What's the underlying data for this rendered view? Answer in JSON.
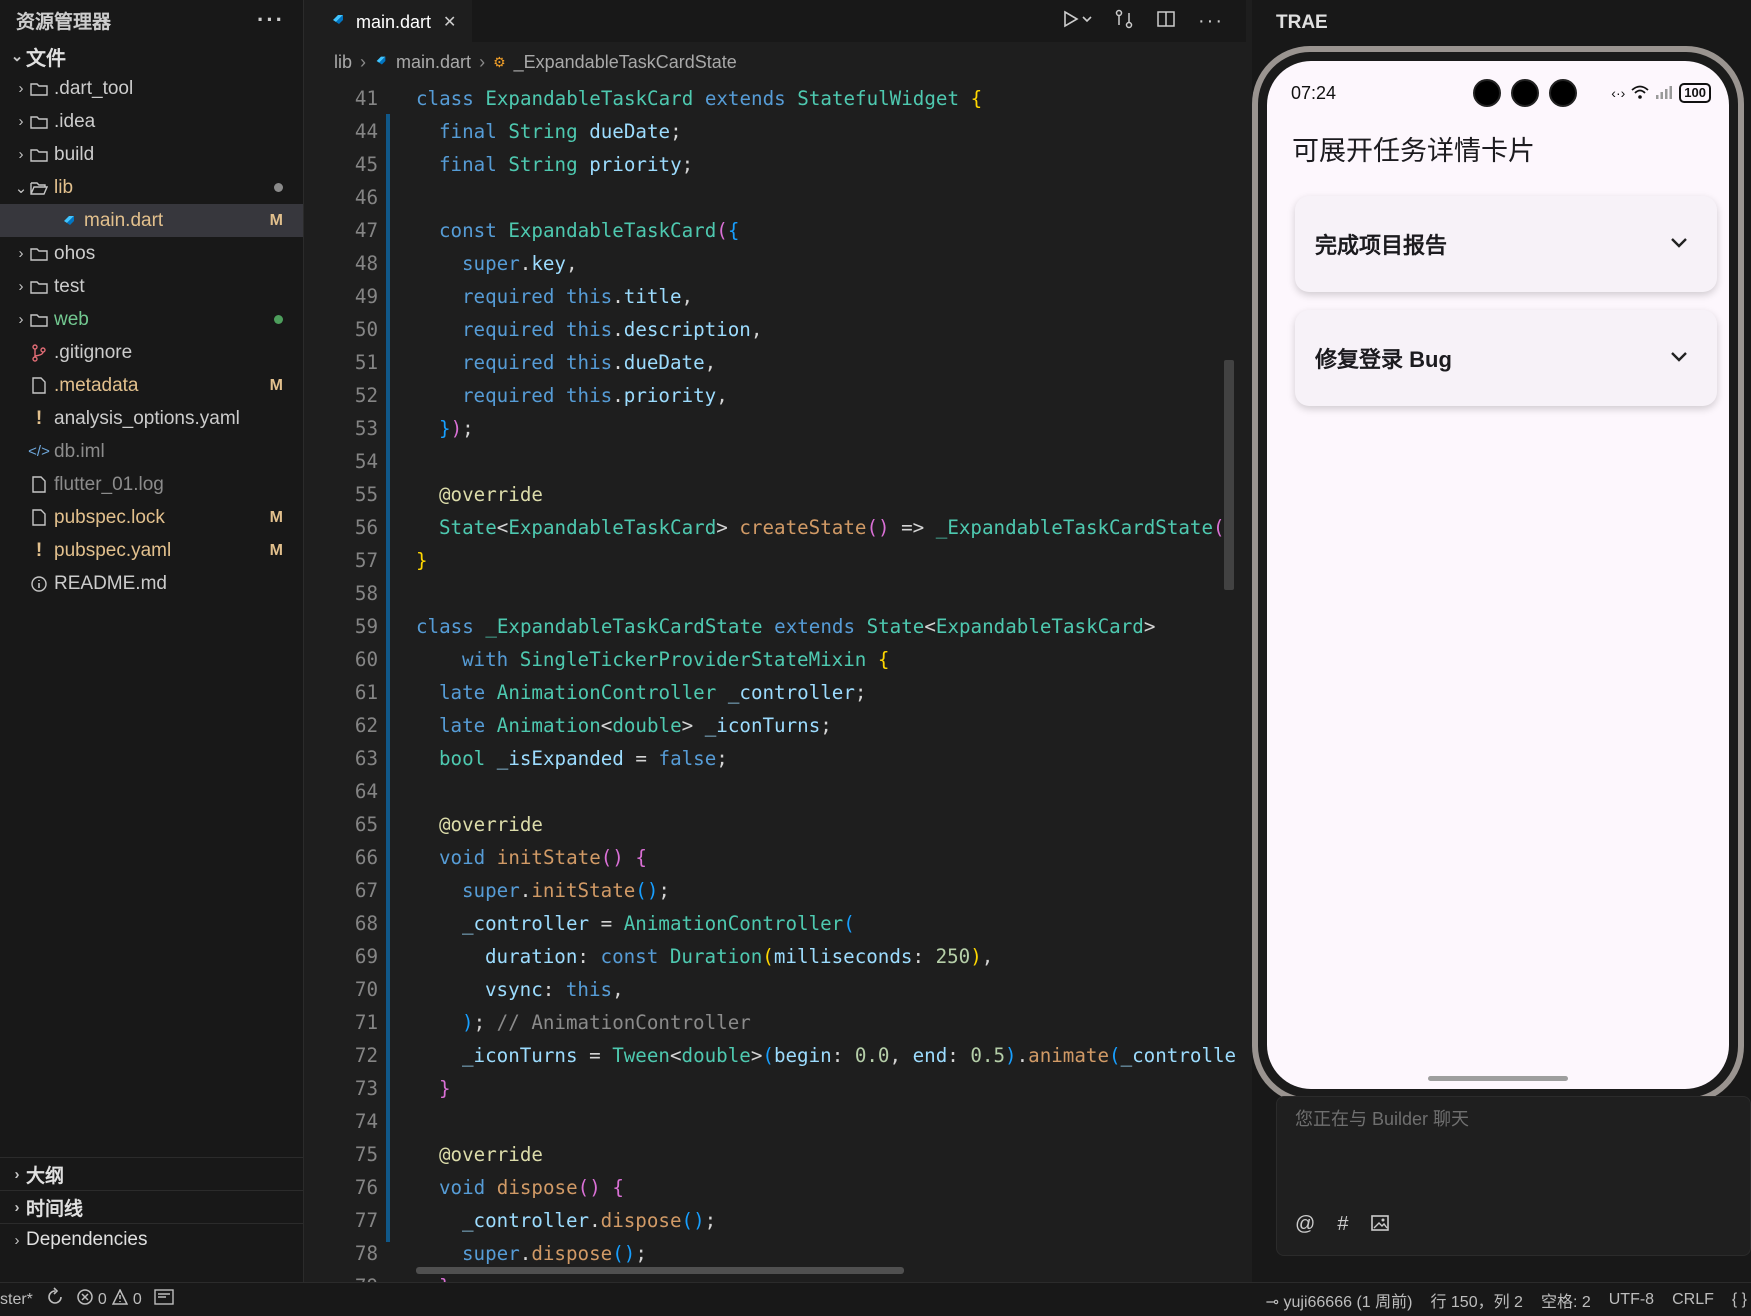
{
  "explorer": {
    "title": "资源管理器",
    "more": "···",
    "section": "文件",
    "items": [
      {
        "label": ".dart_tool",
        "kind": "folder",
        "icon": "folder-icon",
        "depth": 0,
        "badge": "",
        "color": "#cccccc"
      },
      {
        "label": ".idea",
        "kind": "folder",
        "icon": "folder-icon",
        "depth": 0,
        "badge": "",
        "color": "#cccccc"
      },
      {
        "label": "build",
        "kind": "folder",
        "icon": "folder-icon",
        "depth": 0,
        "badge": "",
        "color": "#cccccc"
      },
      {
        "label": "lib",
        "kind": "folder-open",
        "icon": "folder-open-icon",
        "depth": 0,
        "badge": "",
        "color": "#e2c08d",
        "dot": "#8a8a8a"
      },
      {
        "label": "main.dart",
        "kind": "dart",
        "icon": "dart-file-icon",
        "depth": 1,
        "badge": "M",
        "color": "#e2c08d",
        "selected": true
      },
      {
        "label": "ohos",
        "kind": "folder",
        "icon": "folder-icon",
        "depth": 0,
        "badge": "",
        "color": "#cccccc"
      },
      {
        "label": "test",
        "kind": "folder",
        "icon": "folder-icon",
        "depth": 0,
        "badge": "",
        "color": "#cccccc"
      },
      {
        "label": "web",
        "kind": "folder",
        "icon": "folder-icon",
        "depth": 0,
        "badge": "",
        "color": "#73c991",
        "dot": "#4d9e5c"
      },
      {
        "label": ".gitignore",
        "kind": "git",
        "icon": "git-icon",
        "depth": 0,
        "badge": "",
        "color": "#cccccc"
      },
      {
        "label": ".metadata",
        "kind": "file",
        "icon": "file-icon",
        "depth": 0,
        "badge": "M",
        "color": "#e2c08d"
      },
      {
        "label": "analysis_options.yaml",
        "kind": "yaml",
        "icon": "exclamation-icon",
        "depth": 0,
        "badge": "",
        "color": "#cccccc"
      },
      {
        "label": "db.iml",
        "kind": "xml",
        "icon": "code-brackets-icon",
        "depth": 0,
        "badge": "",
        "color": "#8c8c8c"
      },
      {
        "label": "flutter_01.log",
        "kind": "file",
        "icon": "file-icon",
        "depth": 0,
        "badge": "",
        "color": "#8c8c8c"
      },
      {
        "label": "pubspec.lock",
        "kind": "file",
        "icon": "file-icon",
        "depth": 0,
        "badge": "M",
        "color": "#e2c08d"
      },
      {
        "label": "pubspec.yaml",
        "kind": "yaml",
        "icon": "exclamation-icon",
        "depth": 0,
        "badge": "M",
        "color": "#e2c08d"
      },
      {
        "label": "README.md",
        "kind": "info",
        "icon": "info-icon",
        "depth": 0,
        "badge": "",
        "color": "#cccccc"
      }
    ],
    "bottom_sections": [
      "大纲",
      "时间线",
      "Dependencies"
    ]
  },
  "editor": {
    "tab_label": "main.dart",
    "tab_close": "✕",
    "breadcrumb": [
      "lib",
      "main.dart",
      "_ExpandableTaskCardState"
    ],
    "lines": [
      {
        "n": "41",
        "i": 0,
        "t": [
          [
            "class",
            "k"
          ],
          [
            " "
          ],
          [
            "ExpandableTaskCard",
            "t"
          ],
          [
            " "
          ],
          [
            "extends",
            "k"
          ],
          [
            " "
          ],
          [
            "StatefulWidget",
            "t"
          ],
          [
            " "
          ],
          [
            "{",
            "p"
          ]
        ]
      },
      {
        "n": "44",
        "i": 1,
        "t": [
          [
            "final",
            "k"
          ],
          [
            " "
          ],
          [
            "String",
            "t"
          ],
          [
            " "
          ],
          [
            "dueDate",
            "v"
          ],
          [
            ";"
          ]
        ]
      },
      {
        "n": "45",
        "i": 1,
        "t": [
          [
            "final",
            "k"
          ],
          [
            " "
          ],
          [
            "String",
            "t"
          ],
          [
            " "
          ],
          [
            "priority",
            "v"
          ],
          [
            ";"
          ]
        ]
      },
      {
        "n": "46",
        "i": 0,
        "t": []
      },
      {
        "n": "47",
        "i": 1,
        "t": [
          [
            "const",
            "k"
          ],
          [
            " "
          ],
          [
            "ExpandableTaskCard",
            "t"
          ],
          [
            "(",
            "p2"
          ],
          [
            "{",
            "p3"
          ]
        ]
      },
      {
        "n": "48",
        "i": 2,
        "t": [
          [
            "super",
            "k"
          ],
          [
            "."
          ],
          [
            "key",
            "v"
          ],
          [
            ","
          ]
        ]
      },
      {
        "n": "49",
        "i": 2,
        "t": [
          [
            "required",
            "k"
          ],
          [
            " "
          ],
          [
            "this",
            "k"
          ],
          [
            "."
          ],
          [
            "title",
            "v"
          ],
          [
            ","
          ]
        ]
      },
      {
        "n": "50",
        "i": 2,
        "t": [
          [
            "required",
            "k"
          ],
          [
            " "
          ],
          [
            "this",
            "k"
          ],
          [
            "."
          ],
          [
            "description",
            "v"
          ],
          [
            ","
          ]
        ]
      },
      {
        "n": "51",
        "i": 2,
        "t": [
          [
            "required",
            "k"
          ],
          [
            " "
          ],
          [
            "this",
            "k"
          ],
          [
            "."
          ],
          [
            "dueDate",
            "v"
          ],
          [
            ","
          ]
        ]
      },
      {
        "n": "52",
        "i": 2,
        "t": [
          [
            "required",
            "k"
          ],
          [
            " "
          ],
          [
            "this",
            "k"
          ],
          [
            "."
          ],
          [
            "priority",
            "v"
          ],
          [
            ","
          ]
        ]
      },
      {
        "n": "53",
        "i": 1,
        "t": [
          [
            "}",
            "p3"
          ],
          [
            ")",
            "p2"
          ],
          [
            ";"
          ]
        ]
      },
      {
        "n": "54",
        "i": 0,
        "t": []
      },
      {
        "n": "55",
        "i": 1,
        "t": [
          [
            "@override",
            "f"
          ]
        ]
      },
      {
        "n": "56",
        "i": 1,
        "t": [
          [
            "State",
            "t"
          ],
          [
            "<"
          ],
          [
            "ExpandableTaskCard",
            "t"
          ],
          [
            "> "
          ],
          [
            "createState",
            "fn"
          ],
          [
            "()",
            "p2"
          ],
          [
            " => "
          ],
          [
            "_ExpandableTaskCardState",
            "t"
          ],
          [
            "(",
            "p2"
          ]
        ]
      },
      {
        "n": "57",
        "i": 0,
        "t": [
          [
            "}",
            "p"
          ]
        ]
      },
      {
        "n": "58",
        "i": 0,
        "t": []
      },
      {
        "n": "59",
        "i": 0,
        "t": [
          [
            "class",
            "k"
          ],
          [
            " "
          ],
          [
            "_ExpandableTaskCardState",
            "t"
          ],
          [
            " "
          ],
          [
            "extends",
            "k"
          ],
          [
            " "
          ],
          [
            "State",
            "t"
          ],
          [
            "<"
          ],
          [
            "ExpandableTaskCard",
            "t"
          ],
          [
            ">"
          ]
        ]
      },
      {
        "n": "60",
        "i": 2,
        "t": [
          [
            "with",
            "k"
          ],
          [
            " "
          ],
          [
            "SingleTickerProviderStateMixin",
            "t"
          ],
          [
            " "
          ],
          [
            "{",
            "p"
          ]
        ]
      },
      {
        "n": "61",
        "i": 1,
        "t": [
          [
            "late",
            "k"
          ],
          [
            " "
          ],
          [
            "AnimationController",
            "t"
          ],
          [
            " "
          ],
          [
            "_controller",
            "v"
          ],
          [
            ";"
          ]
        ]
      },
      {
        "n": "62",
        "i": 1,
        "t": [
          [
            "late",
            "k"
          ],
          [
            " "
          ],
          [
            "Animation",
            "t"
          ],
          [
            "<"
          ],
          [
            "double",
            "t"
          ],
          [
            "> "
          ],
          [
            "_iconTurns",
            "v"
          ],
          [
            ";"
          ]
        ]
      },
      {
        "n": "63",
        "i": 1,
        "t": [
          [
            "bool",
            "t"
          ],
          [
            " "
          ],
          [
            "_isExpanded",
            "v"
          ],
          [
            " = "
          ],
          [
            "false",
            "k"
          ],
          [
            ";"
          ]
        ]
      },
      {
        "n": "64",
        "i": 0,
        "t": []
      },
      {
        "n": "65",
        "i": 1,
        "t": [
          [
            "@override",
            "f"
          ]
        ]
      },
      {
        "n": "66",
        "i": 1,
        "t": [
          [
            "void",
            "k"
          ],
          [
            " "
          ],
          [
            "initState",
            "fn"
          ],
          [
            "()",
            "p2"
          ],
          [
            " "
          ],
          [
            "{",
            "p2"
          ]
        ]
      },
      {
        "n": "67",
        "i": 2,
        "t": [
          [
            "super",
            "k"
          ],
          [
            "."
          ],
          [
            "initState",
            "fn"
          ],
          [
            "()",
            "p3"
          ],
          [
            ";"
          ]
        ]
      },
      {
        "n": "68",
        "i": 2,
        "t": [
          [
            "_controller",
            "v"
          ],
          [
            " = "
          ],
          [
            "AnimationController",
            "t"
          ],
          [
            "(",
            "p3"
          ]
        ]
      },
      {
        "n": "69",
        "i": 3,
        "t": [
          [
            "duration",
            "v"
          ],
          [
            ": "
          ],
          [
            "const",
            "k"
          ],
          [
            " "
          ],
          [
            "Duration",
            "t"
          ],
          [
            "(",
            "p"
          ],
          [
            "milliseconds",
            "v"
          ],
          [
            ": "
          ],
          [
            "250",
            "n"
          ],
          [
            ")",
            "p"
          ],
          [
            ","
          ]
        ]
      },
      {
        "n": "70",
        "i": 3,
        "t": [
          [
            "vsync",
            "v"
          ],
          [
            ": "
          ],
          [
            "this",
            "k"
          ],
          [
            ","
          ]
        ]
      },
      {
        "n": "71",
        "i": 2,
        "t": [
          [
            ")",
            "p3"
          ],
          [
            "; "
          ],
          [
            "// AnimationController",
            "cg"
          ]
        ]
      },
      {
        "n": "72",
        "i": 2,
        "t": [
          [
            "_iconTurns",
            "v"
          ],
          [
            " = "
          ],
          [
            "Tween",
            "t"
          ],
          [
            "<"
          ],
          [
            "double",
            "t"
          ],
          [
            ">"
          ],
          [
            "(",
            "p3"
          ],
          [
            "begin",
            "v"
          ],
          [
            ": "
          ],
          [
            "0.0",
            "n"
          ],
          [
            ", "
          ],
          [
            "end",
            "v"
          ],
          [
            ": "
          ],
          [
            "0.5",
            "n"
          ],
          [
            ")",
            "p3"
          ],
          [
            "."
          ],
          [
            "animate",
            "fn"
          ],
          [
            "(",
            "p3"
          ],
          [
            "_controlle",
            "v"
          ]
        ]
      },
      {
        "n": "73",
        "i": 1,
        "t": [
          [
            "}",
            "p2"
          ]
        ]
      },
      {
        "n": "74",
        "i": 0,
        "t": []
      },
      {
        "n": "75",
        "i": 1,
        "t": [
          [
            "@override",
            "f"
          ]
        ]
      },
      {
        "n": "76",
        "i": 1,
        "t": [
          [
            "void",
            "k"
          ],
          [
            " "
          ],
          [
            "dispose",
            "fn"
          ],
          [
            "()",
            "p2"
          ],
          [
            " "
          ],
          [
            "{",
            "p2"
          ]
        ]
      },
      {
        "n": "77",
        "i": 2,
        "t": [
          [
            "_controller",
            "v"
          ],
          [
            "."
          ],
          [
            "dispose",
            "fn"
          ],
          [
            "()",
            "p3"
          ],
          [
            ";"
          ]
        ]
      },
      {
        "n": "78",
        "i": 2,
        "t": [
          [
            "super",
            "k"
          ],
          [
            "."
          ],
          [
            "dispose",
            "fn"
          ],
          [
            "()",
            "p3"
          ],
          [
            ";"
          ]
        ]
      },
      {
        "n": "79",
        "i": 1,
        "t": [
          [
            "}",
            "p2"
          ]
        ]
      }
    ]
  },
  "trae": {
    "title": "TRAE",
    "phone": {
      "time": "07:24",
      "battery": "100",
      "app_title": "可展开任务详情卡片",
      "cards": [
        "完成项目报告",
        "修复登录 Bug"
      ]
    },
    "chat_placeholder": "您正在与 Builder 聊天",
    "chat_tools": [
      "@",
      "#",
      "🖼"
    ]
  },
  "statusbar": {
    "branch": "ster*",
    "errors": "0",
    "warnings": "0",
    "blame": "yuji66666 (1 周前)",
    "position": "行 150，列 2",
    "spaces": "空格: 2",
    "encoding": "UTF-8",
    "eol": "CRLF",
    "lang": "{ }"
  }
}
